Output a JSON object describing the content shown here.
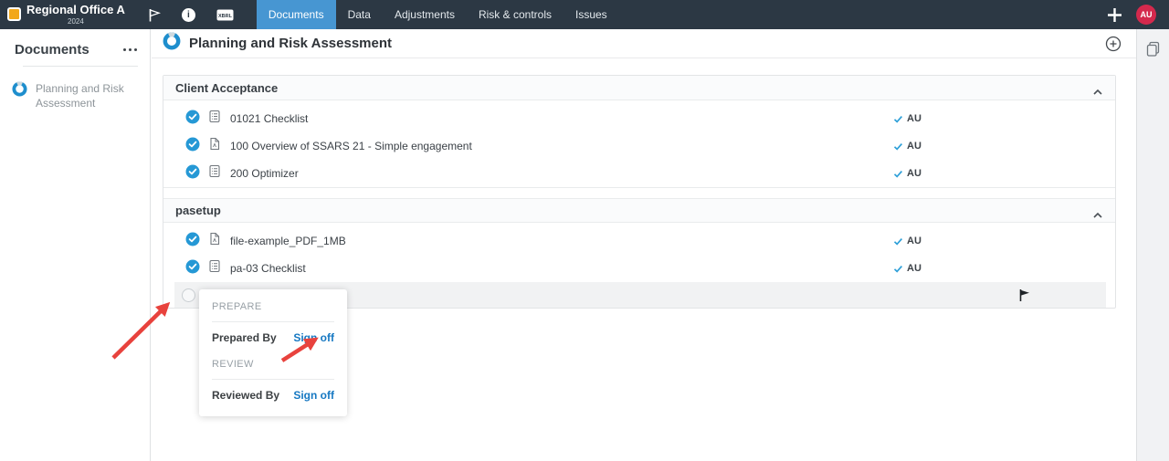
{
  "navbar": {
    "org_name": "Regional Office A",
    "year": "2024",
    "xbrl_icon_label": "XBRL",
    "info_icon_glyph": "i",
    "tabs": [
      {
        "label": "Documents",
        "active": true
      },
      {
        "label": "Data",
        "active": false
      },
      {
        "label": "Adjustments",
        "active": false
      },
      {
        "label": "Risk & controls",
        "active": false
      },
      {
        "label": "Issues",
        "active": false
      }
    ],
    "avatar_initials": "AU"
  },
  "sidebar": {
    "title": "Documents",
    "items": [
      {
        "label": "Planning and Risk Assessment"
      }
    ]
  },
  "main": {
    "page_title": "Planning and Risk Assessment",
    "sections": [
      {
        "title": "Client Acceptance",
        "rows": [
          {
            "label": "01021 Checklist",
            "icon": "checklist",
            "signoff_initials": "AU"
          },
          {
            "label": "100 Overview of SSARS 21 - Simple engagement",
            "icon": "pdf",
            "signoff_initials": "AU"
          },
          {
            "label": "200 Optimizer",
            "icon": "checklist",
            "signoff_initials": "AU"
          }
        ]
      },
      {
        "title": "pasetup",
        "rows": [
          {
            "label": "file-example_PDF_1MB",
            "icon": "pdf",
            "signoff_initials": "AU"
          },
          {
            "label": "pa-03 Checklist",
            "icon": "checklist",
            "signoff_initials": "AU"
          }
        ]
      }
    ]
  },
  "signoff_popup": {
    "prepare_heading": "PREPARE",
    "prepared_by_label": "Prepared By",
    "prepare_signoff_label": "Sign off",
    "review_heading": "REVIEW",
    "reviewed_by_label": "Reviewed By",
    "review_signoff_label": "Sign off"
  },
  "colors": {
    "navbar_bg": "#2c3844",
    "active_tab_blue": "#4796d2",
    "link_blue": "#1678c2",
    "check_blue": "#2598d5",
    "avatar_red": "#d4294d",
    "logo_orange": "#f2a71b",
    "annotation_arrow_red": "#e8423d",
    "highlight_row_gray": "#f1f2f3"
  }
}
